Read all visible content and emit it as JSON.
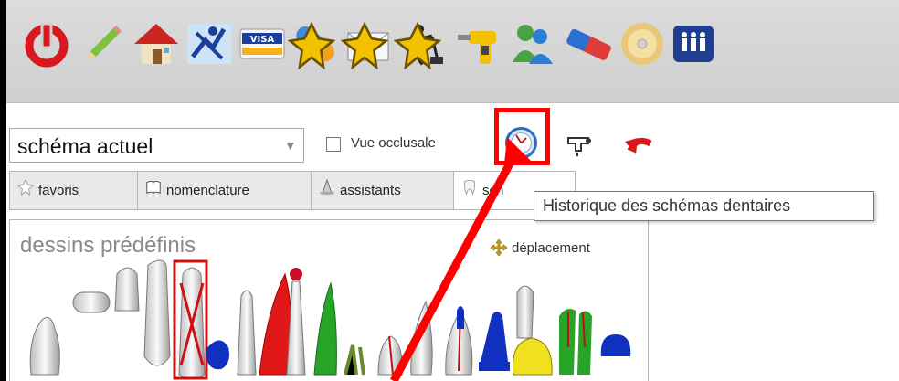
{
  "toolbar": {
    "items": [
      {
        "icon": "power-icon"
      },
      {
        "icon": "pencil-icon"
      },
      {
        "icon": "house-icon"
      },
      {
        "icon": "fitness-icon"
      },
      {
        "icon": "visa-card-icon",
        "text": "VISA"
      },
      {
        "icon": "pill-icon"
      },
      {
        "icon": "envelope-icon"
      },
      {
        "icon": "worker-shovel-icon"
      },
      {
        "icon": "drill-icon"
      },
      {
        "icon": "users-icon"
      },
      {
        "icon": "eraser-icon"
      },
      {
        "icon": "disc-icon"
      },
      {
        "icon": "people-badge-icon"
      }
    ]
  },
  "schema": {
    "selected": "schéma actuel",
    "occlusal_label": "Vue occlusale",
    "occlusal_checked": false
  },
  "tabs": [
    {
      "label": "favoris",
      "icon": "star-icon"
    },
    {
      "label": "nomenclature",
      "icon": "book-icon"
    },
    {
      "label": "assistants",
      "icon": "wizard-icon"
    },
    {
      "label": "sch",
      "icon": "tooth-icon"
    }
  ],
  "tooltip": "Historique des schémas dentaires",
  "panel": {
    "title": "dessins prédéfinis",
    "move_label": "déplacement"
  },
  "colors": {
    "highlight": "#ff0000",
    "toolbar_bg": "#d6d6d6",
    "power_red": "#d8181c"
  }
}
